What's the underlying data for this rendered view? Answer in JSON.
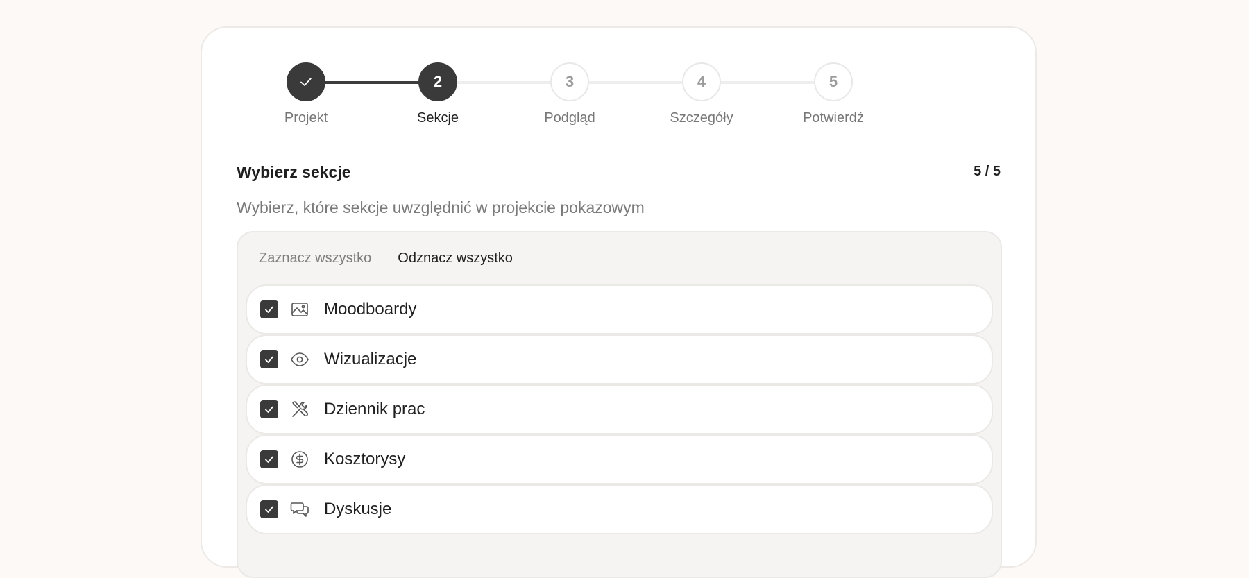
{
  "stepper": {
    "steps": [
      {
        "number": "1",
        "label": "Projekt",
        "state": "done"
      },
      {
        "number": "2",
        "label": "Sekcje",
        "state": "active"
      },
      {
        "number": "3",
        "label": "Podgląd",
        "state": "pending"
      },
      {
        "number": "4",
        "label": "Szczegóły",
        "state": "pending"
      },
      {
        "number": "5",
        "label": "Potwierdź",
        "state": "pending"
      }
    ]
  },
  "section": {
    "title": "Wybierz sekcje",
    "count": "5 / 5",
    "description": "Wybierz, które sekcje uwzględnić w projekcie pokazowym"
  },
  "panel": {
    "select_all_label": "Zaznacz wszystko",
    "deselect_all_label": "Odznacz wszystko",
    "items": [
      {
        "label": "Moodboardy",
        "icon": "image-icon",
        "checked": true
      },
      {
        "label": "Wizualizacje",
        "icon": "eye-icon",
        "checked": true
      },
      {
        "label": "Dziennik prac",
        "icon": "tools-icon",
        "checked": true
      },
      {
        "label": "Kosztorysy",
        "icon": "dollar-circle-icon",
        "checked": true
      },
      {
        "label": "Dyskusje",
        "icon": "chat-bubbles-icon",
        "checked": true
      }
    ]
  },
  "colors": {
    "accent": "#3a3a3a",
    "background": "#fcf9f7",
    "muted_text": "#7a7a7a"
  }
}
